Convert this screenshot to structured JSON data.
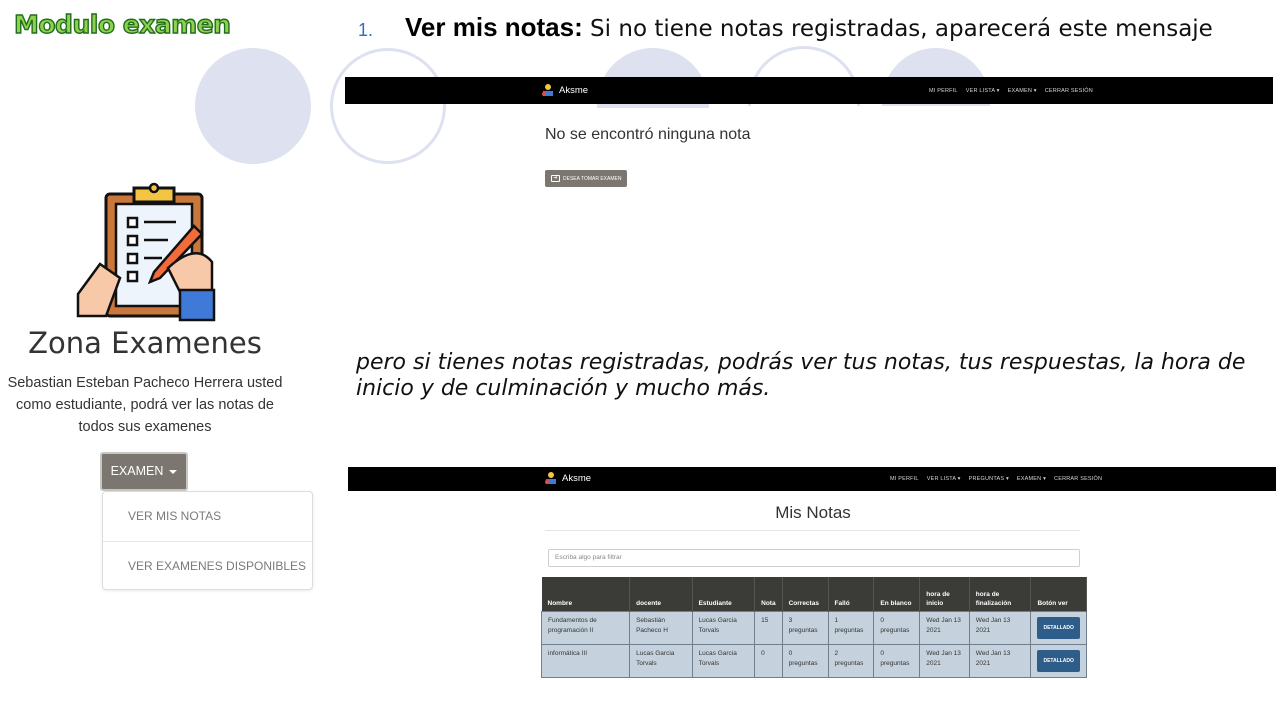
{
  "slide": {
    "title": "Modulo examen",
    "heading_number": "1.",
    "heading_bold": "Ver mis notas:",
    "heading_rest": " Si no tiene notas registradas, aparecerá este mensaje",
    "italic_text": "pero si tienes notas registradas, podrás ver tus notas, tus respuestas, la hora de inicio y de culminación y mucho más."
  },
  "left_panel": {
    "zone_title": "Zona Examenes",
    "description": "Sebastian Esteban Pacheco Herrera usted como estudiante, podrá ver las notas de todos sus examenes",
    "exam_button": "EXAMEN",
    "dropdown_items": [
      "VER MIS NOTAS",
      "VER EXAMENES DISPONIBLES"
    ]
  },
  "screenshot_top": {
    "brand": "Aksme",
    "nav": [
      "MI PERFIL",
      "VER LISTA ▾",
      "EXAMEN ▾",
      "CERRAR SESIÓN"
    ],
    "message": "No se encontró ninguna nota",
    "button": "DESEA TOMAR EXAMEN"
  },
  "screenshot_bottom": {
    "brand": "Aksme",
    "nav": [
      "MI PERFIL",
      "VER LISTA ▾",
      "PREGUNTAS ▾",
      "EXAMEN ▾",
      "CERRAR SESIÓN"
    ],
    "title": "Mis Notas",
    "filter_placeholder": "Escriba algo para filtrar",
    "columns": [
      "Nombre",
      "docente",
      "Estudiante",
      "Nota",
      "Correctas",
      "Falló",
      "En blanco",
      "hora de inicio",
      "hora de finalización",
      "Botón ver"
    ],
    "rows": [
      [
        "Fundamentos de programación II",
        "Sebastián Pacheco H",
        "Lucas Garcia Torvals",
        "15",
        "3 preguntas",
        "1 preguntas",
        "0 preguntas",
        "Wed Jan 13 2021",
        "Wed Jan 13 2021",
        "DETALLADO"
      ],
      [
        "informática III",
        "Lucas Garcia Torvals",
        "Lucas Garcia Torvals",
        "0",
        "0 preguntas",
        "2 preguntas",
        "0 preguntas",
        "Wed Jan 13 2021",
        "Wed Jan 13 2021",
        "DETALLADO"
      ]
    ]
  }
}
